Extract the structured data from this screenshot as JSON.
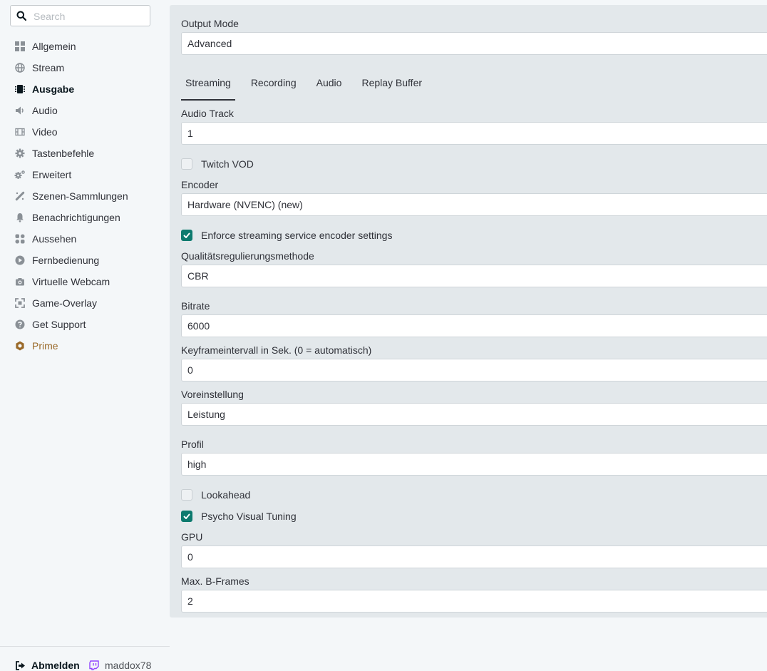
{
  "search": {
    "placeholder": "Search",
    "value": ""
  },
  "nav": [
    {
      "label": "Allgemein",
      "icon": "grid-icon",
      "active": false
    },
    {
      "label": "Stream",
      "icon": "globe-icon",
      "active": false
    },
    {
      "label": "Ausgabe",
      "icon": "chip-icon",
      "active": true
    },
    {
      "label": "Audio",
      "icon": "speaker-icon",
      "active": false
    },
    {
      "label": "Video",
      "icon": "film-icon",
      "active": false
    },
    {
      "label": "Tastenbefehle",
      "icon": "gear-icon",
      "active": false
    },
    {
      "label": "Erweitert",
      "icon": "gears-icon",
      "active": false
    },
    {
      "label": "Szenen-Sammlungen",
      "icon": "wand-icon",
      "active": false
    },
    {
      "label": "Benachrichtigungen",
      "icon": "bell-icon",
      "active": false
    },
    {
      "label": "Aussehen",
      "icon": "palette-icon",
      "active": false
    },
    {
      "label": "Fernbedienung",
      "icon": "play-circle-icon",
      "active": false
    },
    {
      "label": "Virtuelle Webcam",
      "icon": "camera-icon",
      "active": false
    },
    {
      "label": "Game-Overlay",
      "icon": "expand-icon",
      "active": false
    },
    {
      "label": "Get Support",
      "icon": "question-icon",
      "active": false
    },
    {
      "label": "Prime",
      "icon": "prime-icon",
      "active": false
    }
  ],
  "footer": {
    "logout_label": "Abmelden",
    "username": "maddox78"
  },
  "output_mode": {
    "label": "Output Mode",
    "value": "Advanced"
  },
  "tabs": [
    {
      "label": "Streaming",
      "active": true
    },
    {
      "label": "Recording",
      "active": false
    },
    {
      "label": "Audio",
      "active": false
    },
    {
      "label": "Replay Buffer",
      "active": false
    }
  ],
  "settings": {
    "audio_track": {
      "label": "Audio Track",
      "value": "1"
    },
    "twitch_vod": {
      "label": "Twitch VOD",
      "checked": false
    },
    "encoder": {
      "label": "Encoder",
      "value": "Hardware (NVENC) (new)"
    },
    "enforce": {
      "label": "Enforce streaming service encoder settings",
      "checked": true
    },
    "rate_control": {
      "label": "Qualitätsregulierungsmethode",
      "value": "CBR"
    },
    "bitrate": {
      "label": "Bitrate",
      "value": "6000"
    },
    "keyframe": {
      "label": "Keyframeintervall in Sek. (0 = automatisch)",
      "value": "0"
    },
    "preset": {
      "label": "Voreinstellung",
      "value": "Leistung"
    },
    "profile": {
      "label": "Profil",
      "value": "high"
    },
    "lookahead": {
      "label": "Lookahead",
      "checked": false
    },
    "psycho_visual": {
      "label": "Psycho Visual Tuning",
      "checked": true
    },
    "gpu": {
      "label": "GPU",
      "value": "0"
    },
    "bframes": {
      "label": "Max. B-Frames",
      "value": "2"
    }
  },
  "colors": {
    "accent": "#0d7a6e",
    "panel": "#e3e8eb",
    "background": "#f4f7f9",
    "prime": "#9a6a2a"
  }
}
